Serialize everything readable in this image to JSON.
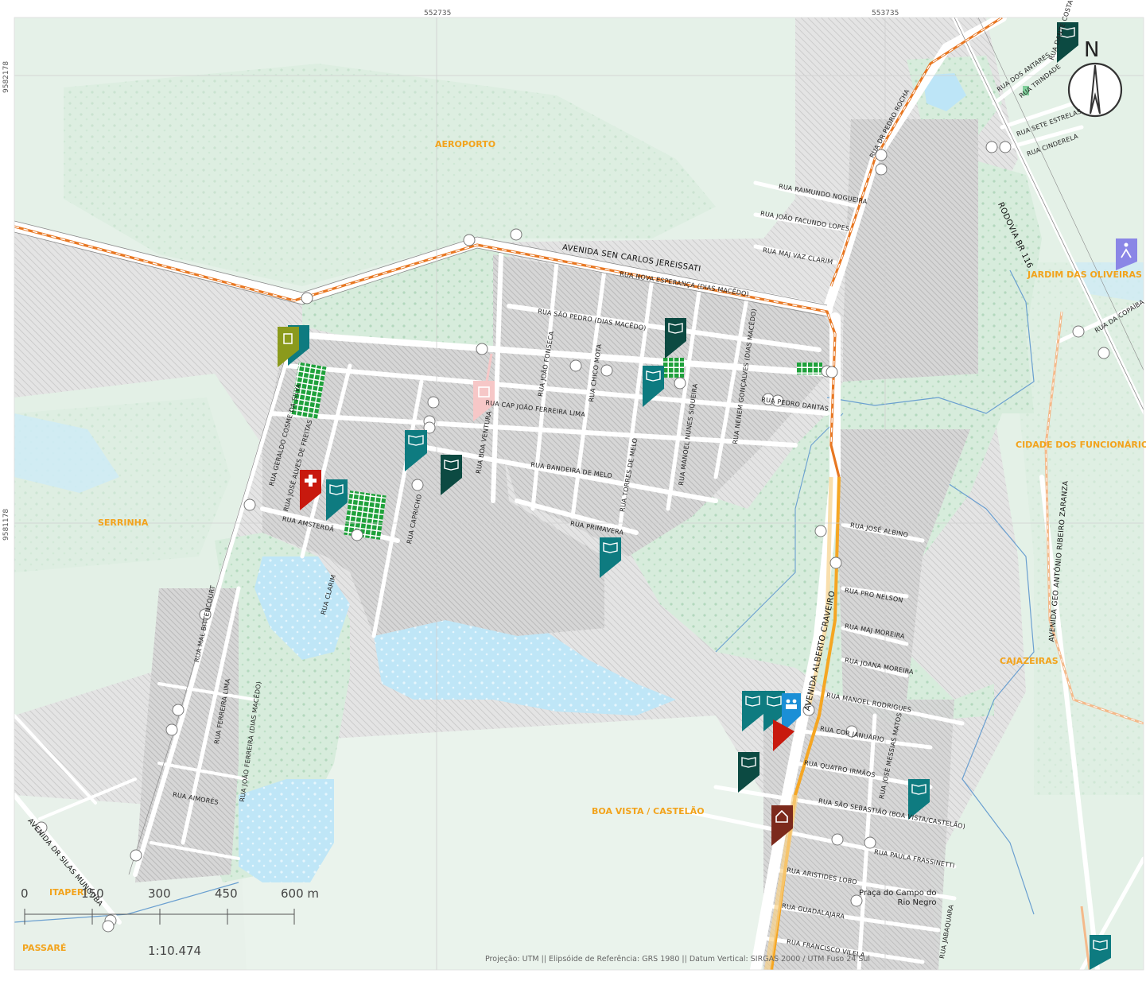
{
  "map": {
    "coords": {
      "top_left": "552735",
      "top_right": "553735",
      "left_top": "9582178",
      "left_bottom": "9581178"
    },
    "neighborhoods": [
      "AEROPORTO",
      "SERRINHA",
      "JARDIM DAS OLIVEIRAS",
      "CIDADE DOS FUNCIONÁRIOS",
      "CAJAZEIRAS",
      "BOA VISTA / CASTELÃO",
      "ITAPERI",
      "PASSARÉ"
    ],
    "avenues": [
      "AVENIDA SEN CARLOS JEREISSATI",
      "AVENIDA ALBERTO CRAVEIRO",
      "RODOVIA BR 116",
      "AVENIDA GEO ANTÔNIO RIBEIRO ZARANZA",
      "AVENIDA DR SILAS MUNGUBA"
    ],
    "streets": [
      "RUA RAIMUNDO NOGUEIRA",
      "RUA JOÃO FACUNDO LOPES",
      "RUA MAJ VAZ CLARIM",
      "RUA NOVA ESPERANÇA (DIAS MACÊDO)",
      "RUA SÃO PEDRO (DIAS MACÊDO)",
      "RUA CAP JOÃO FERREIRA LIMA",
      "RUA PEDRO DANTAS",
      "RUA BANDEIRA DE MELO",
      "RUA PRIMAVERA",
      "RUA AMSTERDÃ",
      "RUA CLARIM",
      "RUA CAPRICHO",
      "RUA BOA VENTURA",
      "RUA JOÃO FONSECA",
      "RUA CHICO MOTA",
      "RUA TORRES DE MELO",
      "RUA MANOEL NUNES SIQUEIRA",
      "RUA NENEM GONÇALVES (DIAS MACÊDO)",
      "RUA GERALDO COSME DA SILVA",
      "RUA JOSÉ ALVES DE FREITAS",
      "RUA MAL BITTENCOURT",
      "RUA FERREIRA LIMA",
      "RUA JOÃO FERREIRA (DIAS MACÊDO)",
      "RUA AIMORÉS",
      "RUA JOSÉ ALBINO",
      "RUA PRO NELSON",
      "RUA MAJ MOREIRA",
      "RUA JOANA MOREIRA",
      "RUA MANOEL RODRIGUES",
      "RUA COR JANUÁRIO",
      "RUA QUATRO IRMÃOS",
      "RUA JOSÉ MESSIAS MATOS",
      "RUA SÃO SEBASTIÃO (BOA VISTA/CASTELÃO)",
      "RUA PAULA FRASSINETTI",
      "RUA ARISTIDES LOBO",
      "RUA GUADALAJARA",
      "RUA FRANCISCO VILELA",
      "RUA JABAQUARA",
      "RUA DR PEDRO ROCHA",
      "RUA DOS ANTARES",
      "RUA TRINDADE",
      "RUA SETE ESTRELAS",
      "RUA CINDERELA",
      "RUA DA COPAÍBA",
      "RUA DANTE COSTA"
    ],
    "praca": [
      "Praça do Campo do",
      "Rio Negro"
    ],
    "north": "N",
    "scale": {
      "labels": [
        "0",
        "150",
        "300",
        "450",
        "600 m"
      ],
      "ratio": "1:10.474"
    },
    "footer": "Projeção: UTM || Elipsóide de Referência:  GRS 1980 || Datum Vertical: SIRGAS 2000 / UTM Fuso 24 Sul",
    "colors": {
      "green_area": "#dceee2",
      "lake": "#c7e9f8",
      "highway": "#f5a623",
      "rail": "#e87722",
      "school": "#0e7b80",
      "school_dark": "#0c4a42",
      "health": "#c8190e",
      "neighborhood": "#f2a31c"
    }
  }
}
